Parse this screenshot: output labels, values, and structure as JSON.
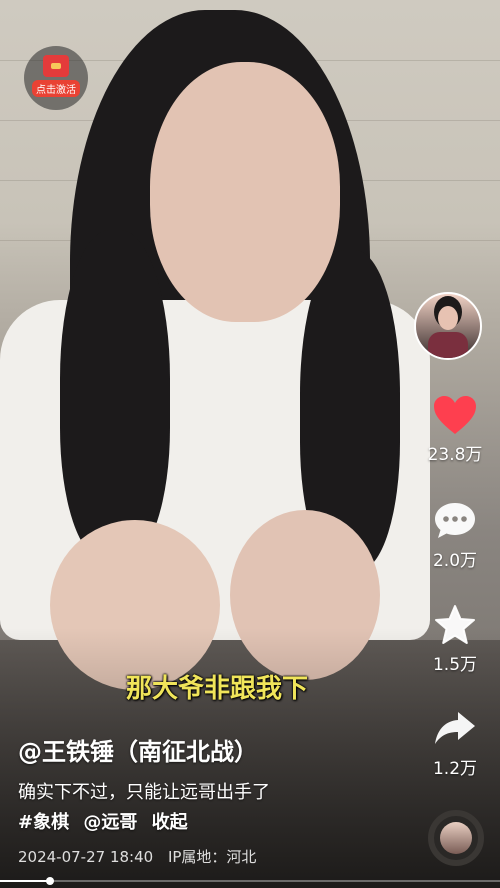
{
  "activate_badge": {
    "label": "点击激活"
  },
  "rail": {
    "likes": "23.8万",
    "comments": "2.0万",
    "favorites": "1.5万",
    "shares": "1.2万"
  },
  "subtitle": "那大爷非跟我下",
  "post": {
    "author": "@王铁锤（南征北战）",
    "description": "确实下不过，只能让远哥出手了",
    "tags": [
      "#象棋",
      "@远哥",
      "收起"
    ],
    "datetime": "2024-07-27 18:40",
    "location": "IP属地：河北"
  },
  "progress": {
    "fraction": 0.1
  },
  "colors": {
    "like": "#fe3f4f",
    "subtitle": "#f0e55a",
    "badge": "#e94234"
  }
}
